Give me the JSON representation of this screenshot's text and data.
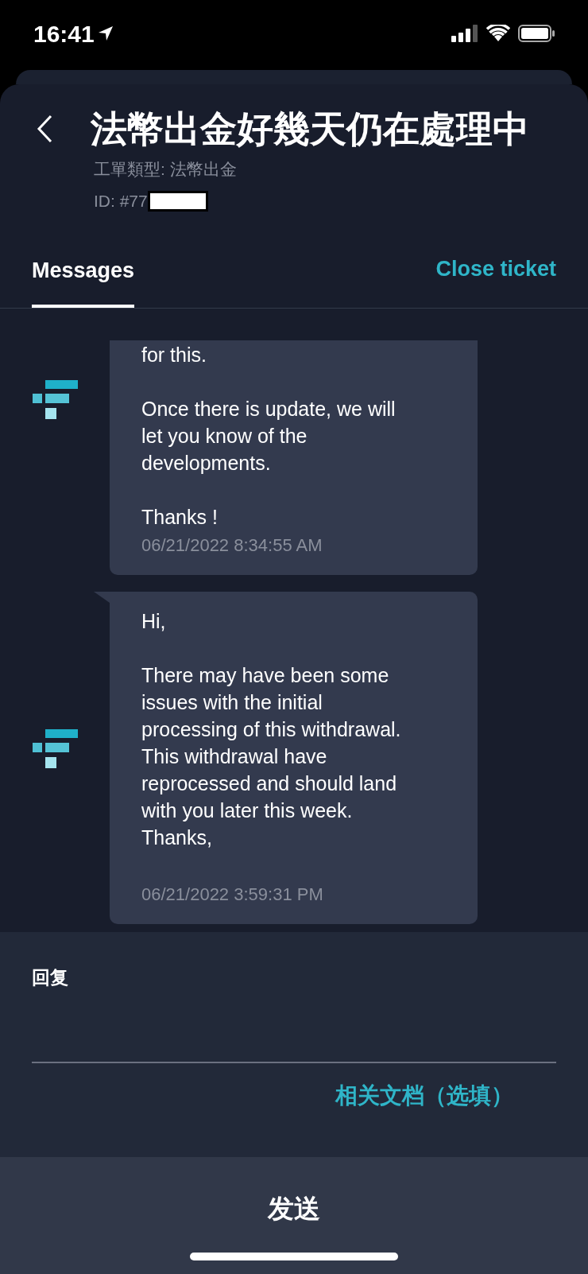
{
  "status_bar": {
    "time": "16:41"
  },
  "header": {
    "title": "法幣出金好幾天仍在處理中",
    "ticket_type": "工單類型: 法幣出金",
    "ticket_id": "ID: #77"
  },
  "tabs": [
    {
      "label": "Messages",
      "selected": true
    }
  ],
  "close_ticket": "Close ticket",
  "messages": [
    {
      "tail": false,
      "paragraphs": [
        "for this.",
        "Once there is update, we will\nlet you know of the\ndevelopments.",
        "Thanks !"
      ],
      "time": "06/21/2022 8:34:55 AM"
    },
    {
      "tail": true,
      "paragraphs": [
        "Hi,",
        "There may have been some\nissues with the initial\nprocessing of this withdrawal.\nThis withdrawal have\nreprocessed and should land\nwith you later this week.\nThanks,"
      ],
      "time": "06/21/2022 3:59:31 PM"
    }
  ],
  "reply": {
    "label": "回复",
    "attachment_link": "相关文档（选填）"
  },
  "send_button": "发送"
}
